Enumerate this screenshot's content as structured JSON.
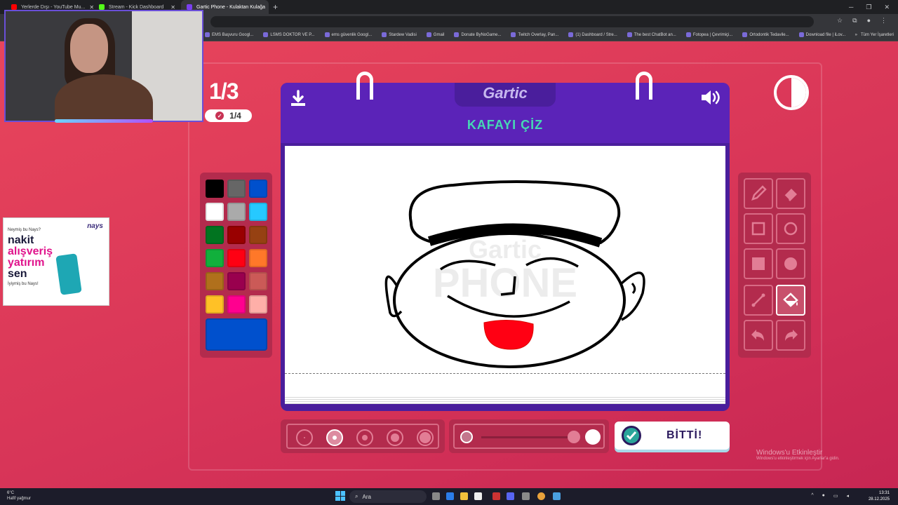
{
  "browser": {
    "tabs": [
      {
        "label": "Yerlerde Dışı - YouTube Mu...",
        "active": false,
        "color": "#ff0000"
      },
      {
        "label": "Stream - Kick Dashboard",
        "active": false,
        "color": "#53fc18"
      },
      {
        "label": "Gartic Phone - Kulaktan Kulağa",
        "active": true,
        "color": "#7a3ff0"
      }
    ],
    "bookmarks": [
      "EMS Başvuru Googl...",
      "LSMS DOKTOR VE P...",
      "ems güvenlik Googl...",
      "Stardew Vadisi",
      "Gmail",
      "Donate ByNoGame...",
      "Twitch Overlay, Pan...",
      "(1) Dashboard / Stre...",
      "The best ChatBot an...",
      "Fotopea | Çevrimiçi...",
      "Ortodontik Tedavile...",
      "Download file | iLov..."
    ],
    "bookmarks_more": "»",
    "all_bookmarks": "Tüm Yer İşaretleri"
  },
  "game": {
    "round": "1/3",
    "sub_round": "1/4",
    "logo": "Gartic",
    "prompt": "KAFAYI ÇİZ",
    "done_label": "BİTTİ!",
    "palette": [
      "#000000",
      "#666666",
      "#0050cd",
      "#ffffff",
      "#aaaaaa",
      "#26c9ff",
      "#017420",
      "#990000",
      "#964112",
      "#11b03c",
      "#ff0013",
      "#ff7829",
      "#b0701c",
      "#99004e",
      "#cb5a57",
      "#ffc126",
      "#ff008f",
      "#feafa8"
    ],
    "current_color": "#0050cd",
    "tools": [
      "pencil",
      "eraser",
      "rect-outline",
      "circle-outline",
      "rect-fill",
      "circle-fill",
      "line",
      "fill-bucket",
      "undo",
      "redo"
    ],
    "selected_tool": "fill-bucket",
    "selected_brush_size_index": 1,
    "opacity": 1.0,
    "windows_activate": {
      "title": "Windows'u Etkinleştir",
      "subtitle": "Windows'u etkinleştirmek için Ayarlar'a gidin."
    }
  },
  "ad": {
    "tagline": "Neymiş bu Nays?",
    "logo": "nays",
    "lines": [
      "nakit",
      "alışveriş",
      "yatırım",
      "sen"
    ],
    "footer": "İyiymiş bu Nays!"
  },
  "taskbar": {
    "temperature": "6°C",
    "weather": "Hafif yağmur",
    "search": "Ara",
    "time": "13:31",
    "date": "28.12.2025"
  }
}
